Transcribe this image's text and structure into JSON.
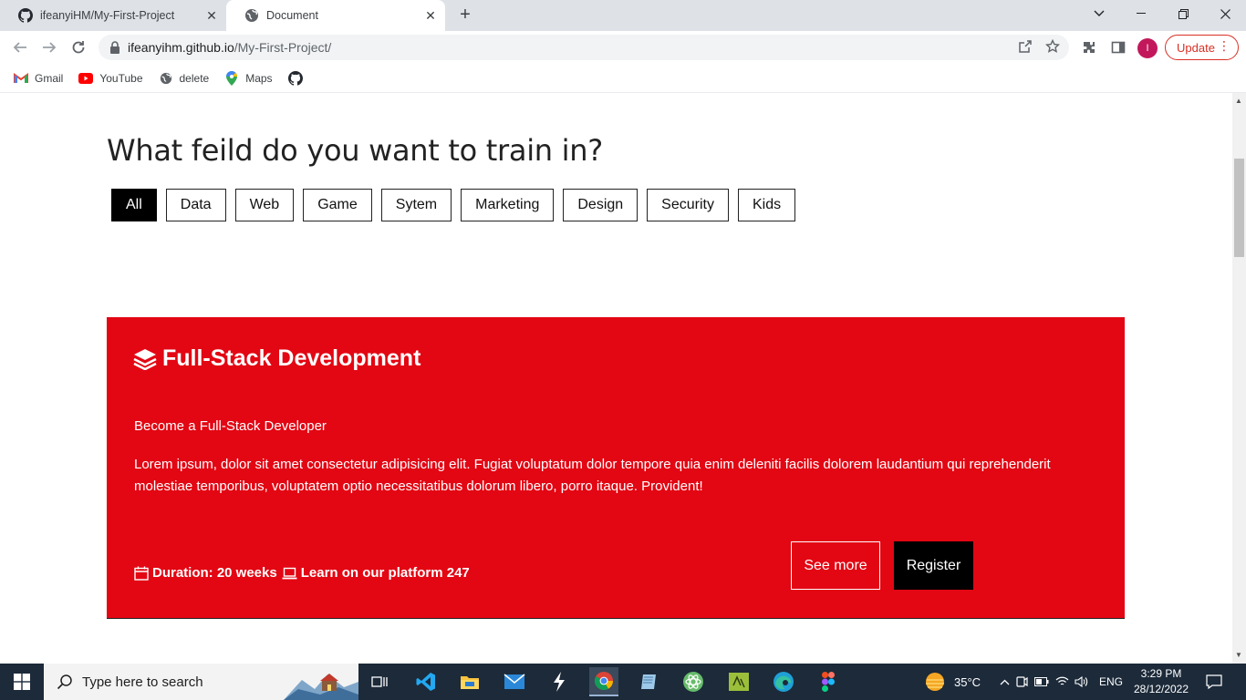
{
  "browser": {
    "tabs": [
      {
        "title": "ifeanyiHM/My-First-Project",
        "favicon": "github-icon",
        "active": false
      },
      {
        "title": "Document",
        "favicon": "globe-icon",
        "active": true
      }
    ],
    "url_host": "ifeanyihm.github.io",
    "url_path": "/My-First-Project/",
    "avatar_letter": "I",
    "update_label": "Update",
    "bookmarks": [
      {
        "label": "Gmail",
        "icon": "gmail-icon"
      },
      {
        "label": "YouTube",
        "icon": "youtube-icon"
      },
      {
        "label": "delete",
        "icon": "globe-icon"
      },
      {
        "label": "Maps",
        "icon": "maps-icon"
      },
      {
        "label": "",
        "icon": "github-icon"
      }
    ]
  },
  "page": {
    "heading": "What feild do you want to train in?",
    "filters": [
      "All",
      "Data",
      "Web",
      "Game",
      "Sytem",
      "Marketing",
      "Design",
      "Security",
      "Kids"
    ],
    "active_filter": "All",
    "card": {
      "title": "Full-Stack Development",
      "subtitle": "Become a Full-Stack Developer",
      "description": "Lorem ipsum, dolor sit amet consectetur adipisicing elit. Fugiat voluptatum dolor tempore quia enim deleniti facilis dolorem laudantium qui reprehenderit molestiae temporibus, voluptatem optio necessitatibus dolorum libero, porro itaque. Provident!",
      "duration": "Duration: 20 weeks",
      "platform": "Learn on our platform 247",
      "see_more_label": "See more",
      "register_label": "Register",
      "color": "#e30613"
    }
  },
  "taskbar": {
    "search_placeholder": "Type here to search",
    "weather": "35°C",
    "language": "ENG",
    "time": "3:29 PM",
    "date": "28/12/2022"
  }
}
